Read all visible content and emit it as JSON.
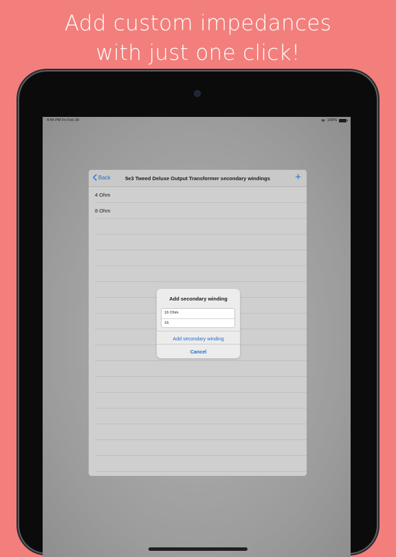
{
  "headline": {
    "line1": "Add custom impedances",
    "line2": "with just one click!"
  },
  "status_bar": {
    "time_date": "4:44 PM   Fri Feb 28",
    "battery": "100%",
    "icons": [
      "wifi-icon",
      "battery-icon"
    ]
  },
  "nav": {
    "back_label": "Back",
    "title": "5e3 Tweed Deluxe Output Transformer secondary windings",
    "add_label": "+"
  },
  "list": {
    "items": [
      {
        "label": "4 Ohm"
      },
      {
        "label": "8 Ohm"
      },
      {
        "label": ""
      },
      {
        "label": ""
      },
      {
        "label": ""
      },
      {
        "label": ""
      },
      {
        "label": ""
      },
      {
        "label": ""
      },
      {
        "label": ""
      },
      {
        "label": ""
      },
      {
        "label": ""
      },
      {
        "label": ""
      },
      {
        "label": ""
      },
      {
        "label": ""
      },
      {
        "label": ""
      },
      {
        "label": ""
      },
      {
        "label": ""
      },
      {
        "label": ""
      }
    ]
  },
  "alert": {
    "title": "Add secondary winding",
    "name_value": "16 Ohm",
    "impedance_value": "16",
    "add_label": "Add secondary winding",
    "cancel_label": "Cancel"
  },
  "colors": {
    "background": "#f27f7c",
    "accent": "#1e6fc8"
  }
}
